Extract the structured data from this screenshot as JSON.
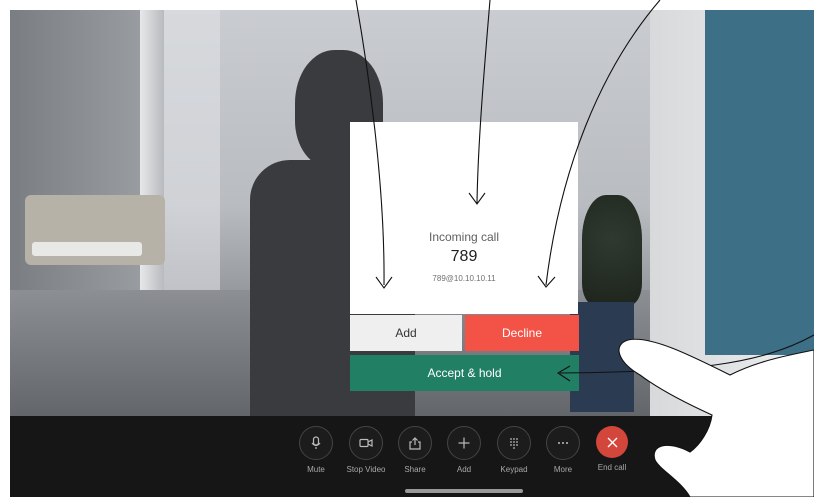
{
  "dialog": {
    "incoming_label": "Incoming call",
    "caller_name": "789",
    "caller_uri": "789@10.10.10.11"
  },
  "actions": {
    "add_label": "Add",
    "decline_label": "Decline",
    "accept_hold_label": "Accept & hold"
  },
  "toolbar": {
    "items": [
      {
        "label": "Mute",
        "icon": "microphone-icon"
      },
      {
        "label": "Stop Video",
        "icon": "camera-icon"
      },
      {
        "label": "Share",
        "icon": "share-icon"
      },
      {
        "label": "Add",
        "icon": "plus-icon"
      },
      {
        "label": "Keypad",
        "icon": "keypad-icon"
      },
      {
        "label": "More",
        "icon": "more-icon"
      },
      {
        "label": "End call",
        "icon": "close-icon"
      }
    ]
  },
  "colors": {
    "accept": "#217f63",
    "decline": "#f25346",
    "end_call": "#d2463b",
    "toolbar_bg": "#161616"
  }
}
